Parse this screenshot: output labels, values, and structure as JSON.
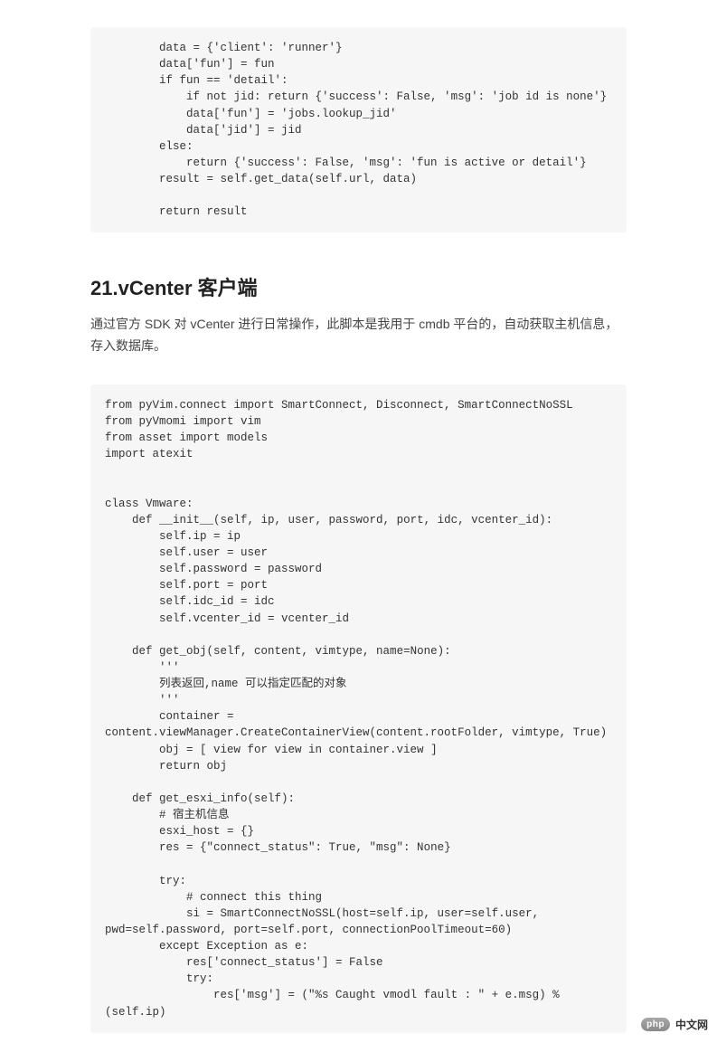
{
  "code_block_1": "        data = {'client': 'runner'}\n        data['fun'] = fun\n        if fun == 'detail':\n            if not jid: return {'success': False, 'msg': 'job id is none'}\n            data['fun'] = 'jobs.lookup_jid'\n            data['jid'] = jid\n        else:\n            return {'success': False, 'msg': 'fun is active or detail'}\n        result = self.get_data(self.url, data)\n\n        return result",
  "heading": "21.vCenter 客户端",
  "paragraph": "通过官方 SDK 对 vCenter 进行日常操作，此脚本是我用于 cmdb 平台的，自动获取主机信息，存入数据库。",
  "code_block_2": "from pyVim.connect import SmartConnect, Disconnect, SmartConnectNoSSL\nfrom pyVmomi import vim\nfrom asset import models\nimport atexit\n\n\nclass Vmware:\n    def __init__(self, ip, user, password, port, idc, vcenter_id):\n        self.ip = ip\n        self.user = user\n        self.password = password\n        self.port = port\n        self.idc_id = idc\n        self.vcenter_id = vcenter_id\n\n    def get_obj(self, content, vimtype, name=None):\n        '''\n        列表返回,name 可以指定匹配的对象\n        '''\n        container = content.viewManager.CreateContainerView(content.rootFolder, vimtype, True)\n        obj = [ view for view in container.view ]\n        return obj\n\n    def get_esxi_info(self):\n        # 宿主机信息\n        esxi_host = {}\n        res = {\"connect_status\": True, \"msg\": None}\n\n        try:\n            # connect this thing\n            si = SmartConnectNoSSL(host=self.ip, user=self.user, pwd=self.password, port=self.port, connectionPoolTimeout=60)\n        except Exception as e:\n            res['connect_status'] = False\n            try:\n                res['msg'] = (\"%s Caught vmodl fault : \" + e.msg) % (self.ip)",
  "watermark": {
    "badge": "php",
    "text": "中文网"
  }
}
